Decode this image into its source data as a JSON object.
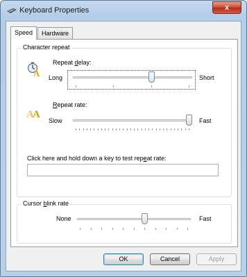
{
  "window": {
    "title": "Keyboard Properties",
    "close_glyph": "x"
  },
  "tabs": [
    {
      "label": "Speed",
      "active": true
    },
    {
      "label": "Hardware",
      "active": false
    }
  ],
  "character_repeat": {
    "group_label": "Character repeat",
    "repeat_delay": {
      "label": "Repeat delay:",
      "min_label": "Long",
      "max_label": "Short",
      "value_fraction": 0.67,
      "icon": "repeat-delay-icon"
    },
    "repeat_rate": {
      "label": "Repeat rate:",
      "min_label": "Slow",
      "max_label": "Fast",
      "value_fraction": 1.0,
      "icon": "repeat-rate-icon"
    },
    "test_label": "Click here and hold down a key to test repeat rate:",
    "test_value": ""
  },
  "cursor_blink": {
    "group_label": "Cursor blink rate",
    "min_label": "None",
    "max_label": "Fast",
    "value_fraction": 0.6
  },
  "buttons": {
    "ok": "OK",
    "cancel": "Cancel",
    "apply": "Apply"
  },
  "colors": {
    "title_bar": "#b9d0ea",
    "close_button": "#c8452d",
    "accent": "#3c7fb1"
  }
}
